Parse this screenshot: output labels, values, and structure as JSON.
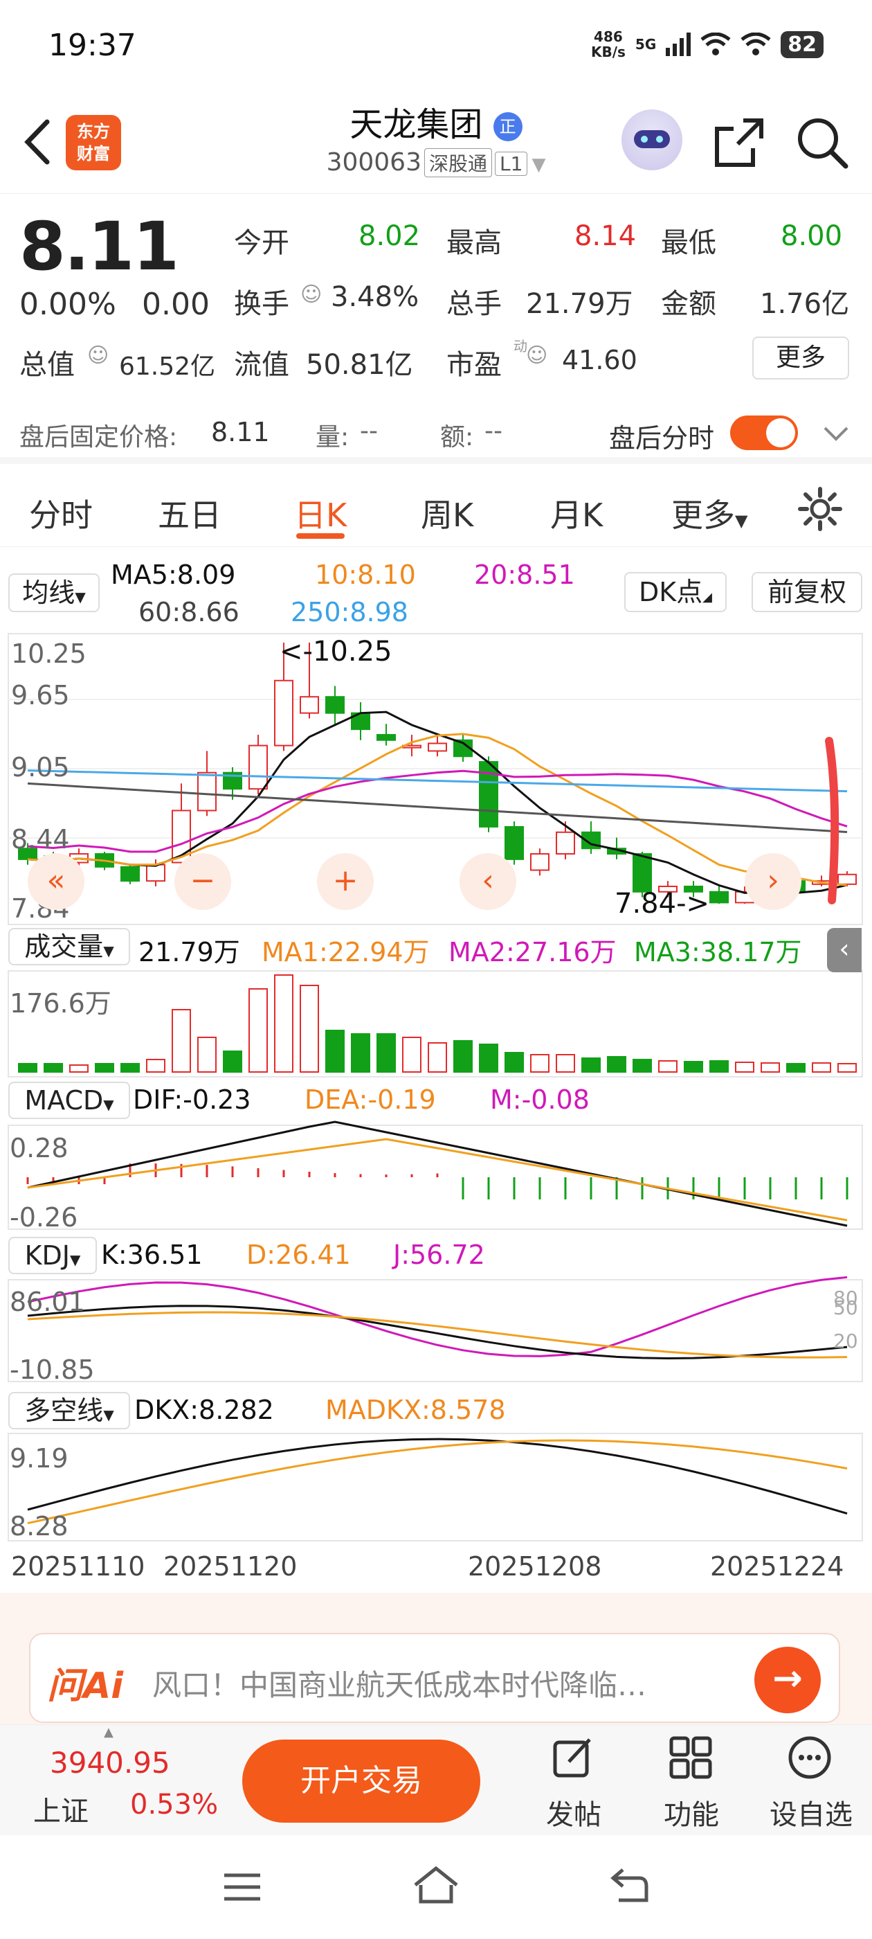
{
  "status_bar": {
    "time": "19:37",
    "net_speed_value": "486",
    "net_speed_unit": "KB/s",
    "signal": "5G",
    "battery": "82"
  },
  "header": {
    "logo_line1": "东方",
    "logo_line2": "财富",
    "stock_name": "天龙集团",
    "badge": "正",
    "stock_code": "300063",
    "tag_sgt": "深股通",
    "tag_l1": "L1"
  },
  "quote": {
    "price": "8.11",
    "change_pct": "0.00%",
    "change": "0.00",
    "open_label": "今开",
    "open": "8.02",
    "high_label": "最高",
    "high": "8.14",
    "low_label": "最低",
    "low": "8.00",
    "turnover_label": "换手",
    "turnover": "3.48%",
    "volume_label": "总手",
    "volume": "21.79万",
    "amount_label": "金额",
    "amount": "1.76亿",
    "mcap_label": "总值",
    "mcap": "61.52亿",
    "float_label": "流值",
    "float": "50.81亿",
    "pe_label": "市盈",
    "pe_sup": "动",
    "pe": "41.60",
    "more": "更多"
  },
  "after_hours": {
    "price_label": "盘后固定价格:",
    "price": "8.11",
    "vol_label": "量:",
    "vol": "--",
    "amt_label": "额:",
    "amt": "--",
    "switch_label": "盘后分时"
  },
  "tabs": [
    "分时",
    "五日",
    "日K",
    "周K",
    "月K",
    "更多"
  ],
  "active_tab": "日K",
  "ma_legend": {
    "dropdown": "均线",
    "ma5": "MA5:8.09",
    "ma10": "10:8.10",
    "ma20": "20:8.51",
    "ma60": "60:8.66",
    "ma250": "250:8.98",
    "dk": "DK点",
    "fq": "前复权"
  },
  "main_axis": {
    "y1": "10.25",
    "y2": "9.65",
    "y3": "9.05",
    "y4": "8.44",
    "y5": "7.84",
    "high_note": "<-10.25",
    "low_note": "7.84->"
  },
  "volume_legend": {
    "dropdown": "成交量",
    "vol": "21.79万",
    "ma1": "MA1:22.94万",
    "ma2": "MA2:27.16万",
    "ma3": "MA3:38.17万",
    "axis": "176.6万"
  },
  "macd_legend": {
    "dropdown": "MACD",
    "dif": "DIF:-0.23",
    "dea": "DEA:-0.19",
    "m": "M:-0.08",
    "axis_top": "0.28",
    "axis_bottom": "-0.26"
  },
  "kdj_legend": {
    "dropdown": "KDJ",
    "k": "K:36.51",
    "d": "D:26.41",
    "j": "J:56.72",
    "axis_top": "86.01",
    "axis_bottom": "-10.85",
    "r80": "80",
    "r50": "50",
    "r20": "20"
  },
  "dkx_legend": {
    "dropdown": "多空线",
    "dkx": "DKX:8.282",
    "madkx": "MADKX:8.578",
    "axis_top": "9.19",
    "axis_bottom": "8.28"
  },
  "dates": [
    "20251110",
    "20251120",
    "20251208",
    "20251224"
  ],
  "ai": {
    "logo": "问Ai",
    "text": "风口！中国商业航天低成本时代降临…"
  },
  "bottom": {
    "index_value": "3940.95",
    "index_name": "上证",
    "index_change": "0.53%",
    "trade": "开户交易",
    "post": "发帖",
    "func": "功能",
    "watch": "设自选"
  },
  "colors": {
    "accent": "#f05a22",
    "up": "#e32b2b",
    "down": "#12a019",
    "ma5": "#111111",
    "ma10": "#f0a020",
    "ma20": "#d019b8",
    "ma60": "#555555",
    "ma250": "#4aa8e8"
  }
}
